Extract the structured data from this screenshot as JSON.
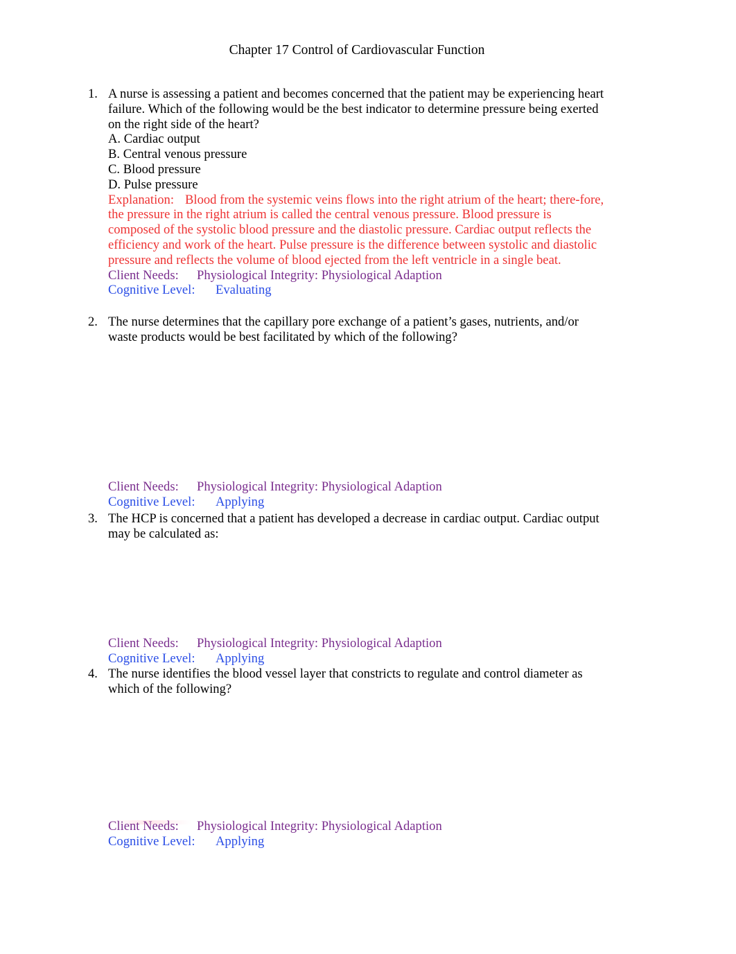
{
  "document": {
    "title": "Chapter 17 Control of Cardiovascular Function",
    "colors": {
      "explanation": "#ee3333",
      "client_needs": "#7a2e8e",
      "cognitive_level": "#2b4ee6"
    },
    "questions": [
      {
        "number": "1.",
        "text": "A nurse is assessing a patient and becomes concerned that the patient may be experiencing heart failure. Which of the following would be the best indicator to determine pressure being exerted on the right side of the heart?",
        "options": [
          "A. Cardiac output",
          "B. Central venous pressure",
          "C. Blood pressure",
          "D. Pulse pressure"
        ],
        "explanation_label": "Explanation:",
        "explanation": "Blood from the systemic veins flows into the right atrium of the heart; there-fore, the pressure in the right atrium is called the central venous pressure. Blood pressure is composed of the systolic blood pressure and the diastolic pressure. Cardiac output reflects the efficiency and work of the heart. Pulse pressure is the difference between systolic and diastolic pressure and reflects the volume of blood ejected from the left ventricle in a single beat.",
        "client_needs_label": "Client Needs:",
        "client_needs": "Physiological Integrity: Physiological Adaption",
        "cognitive_level_label": "Cognitive Level:",
        "cognitive_level": "Evaluating"
      },
      {
        "number": "2.",
        "text": "The nurse determines that the capillary pore exchange of a patient’s gases, nutrients, and/or waste products would be best facilitated by which of the following?",
        "client_needs_label": "Client Needs:",
        "client_needs": "Physiological Integrity: Physiological Adaption",
        "cognitive_level_label": "Cognitive Level:",
        "cognitive_level": "Applying"
      },
      {
        "number": "3.",
        "text": "The HCP is concerned that a patient has developed a decrease in cardiac output. Cardiac output may be calculated as:",
        "client_needs_label": "Client Needs:",
        "client_needs": "Physiological Integrity: Physiological Adaption",
        "cognitive_level_label": "Cognitive Level:",
        "cognitive_level": "Applying"
      },
      {
        "number": "4.",
        "text": "The nurse identifies the blood vessel layer that constricts to regulate and control diameter as which of the following?",
        "client_needs_label": "Client Needs:",
        "client_needs": "Physiological Integrity: Physiological Adaption",
        "cognitive_level_label": "Cognitive Level:",
        "cognitive_level": "Applying"
      }
    ]
  }
}
